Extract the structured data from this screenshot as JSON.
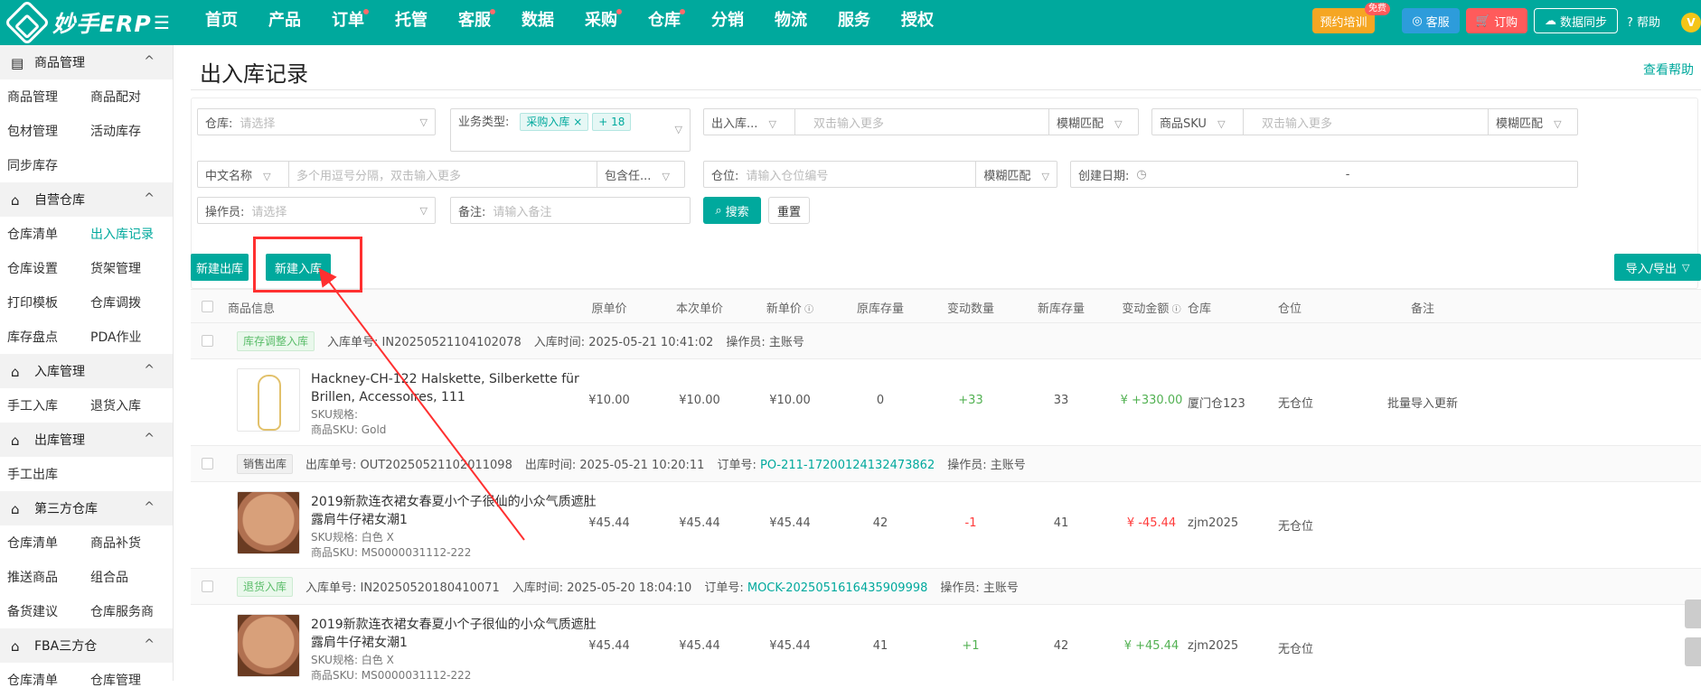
{
  "topbar": {
    "brand": "妙手ERP",
    "nav": [
      {
        "label": "首页",
        "dot": false
      },
      {
        "label": "产品",
        "dot": false
      },
      {
        "label": "订单",
        "dot": true
      },
      {
        "label": "托管",
        "dot": false
      },
      {
        "label": "客服",
        "dot": true
      },
      {
        "label": "数据",
        "dot": false
      },
      {
        "label": "采购",
        "dot": true
      },
      {
        "label": "仓库",
        "dot": true
      },
      {
        "label": "分销",
        "dot": false
      },
      {
        "label": "物流",
        "dot": false
      },
      {
        "label": "服务",
        "dot": false
      },
      {
        "label": "授权",
        "dot": false
      }
    ],
    "training": "预约培训",
    "free_badge": "免费",
    "service": "客服",
    "order": "订购",
    "sync": "数据同步",
    "help": "帮助",
    "avatar": "V"
  },
  "sidebar": {
    "groups": [
      {
        "title": "商品管理",
        "icon": "clipboard-icon",
        "items": [
          [
            "商品管理",
            "商品配对"
          ],
          [
            "包材管理",
            "活动库存"
          ],
          [
            "同步库存",
            ""
          ]
        ]
      },
      {
        "title": "自营仓库",
        "icon": "warehouse-icon",
        "items": [
          [
            "仓库清单",
            "出入库记录"
          ],
          [
            "仓库设置",
            "货架管理"
          ],
          [
            "打印模板",
            "仓库调拨"
          ],
          [
            "库存盘点",
            "PDA作业"
          ]
        ]
      },
      {
        "title": "入库管理",
        "icon": "warehouse-icon",
        "items": [
          [
            "手工入库",
            "退货入库"
          ]
        ]
      },
      {
        "title": "出库管理",
        "icon": "warehouse-icon",
        "items": [
          [
            "手工出库",
            ""
          ]
        ]
      },
      {
        "title": "第三方仓库",
        "icon": "warehouse-icon",
        "items": [
          [
            "仓库清单",
            "商品补货"
          ],
          [
            "推送商品",
            "组合品"
          ],
          [
            "备货建议",
            "仓库服务商"
          ]
        ]
      },
      {
        "title": "FBA三方仓",
        "icon": "warehouse-icon",
        "items": [
          [
            "仓库清单",
            "仓库管理"
          ]
        ]
      }
    ]
  },
  "page": {
    "title": "出入库记录",
    "help_link": "查看帮助"
  },
  "filters": {
    "warehouse_label": "仓库:",
    "warehouse_ph": "请选择",
    "biz_type_label": "业务类型:",
    "biz_type_tag": "采购入库",
    "biz_type_more": "+ 18",
    "inout_select": "出入库...",
    "inout_ph": "双击输入更多",
    "fuzzy1": "模糊匹配",
    "sku_select": "商品SKU",
    "sku_ph": "双击输入更多",
    "fuzzy2": "模糊匹配",
    "cn_name_select": "中文名称",
    "cn_name_ph": "多个用逗号分隔，双击输入更多",
    "contain_select": "包含任...",
    "location_label": "仓位:",
    "location_ph": "请输入仓位编号",
    "fuzzy3": "模糊匹配",
    "created_label": "创建日期:",
    "date_sep": "-",
    "operator_label": "操作员:",
    "operator_ph": "请选择",
    "remark_label": "备注:",
    "remark_ph": "请输入备注",
    "search": "搜索",
    "reset": "重置"
  },
  "actions": {
    "new_out": "新建出库",
    "new_in": "新建入库",
    "import_export": "导入/导出"
  },
  "table": {
    "headers": [
      "商品信息",
      "原单价",
      "本次单价",
      "新单价",
      "原库存量",
      "变动数量",
      "新库存量",
      "变动金额",
      "仓库",
      "仓位",
      "备注"
    ],
    "records": [
      {
        "tag": "库存调整入库",
        "tag_style": "green",
        "no_label": "入库单号:",
        "no": "IN20250521104102078",
        "time_label": "入库时间:",
        "time": "2025-05-21 10:41:02",
        "order_label": "",
        "order_no": "",
        "op_label": "操作员:",
        "op": "主账号",
        "product": {
          "name": "Hackney-CH-122 Halskette, Silberkette für Brillen, Accessoires, 111",
          "sku_spec": "SKU规格:",
          "sku": "商品SKU:   Gold",
          "thumb": "necklace"
        },
        "orig_price": "¥10.00",
        "this_price": "¥10.00",
        "new_price": "¥10.00",
        "orig_stock": "0",
        "change_qty": "+33",
        "new_stock": "33",
        "change_amt": "¥ +330.00",
        "warehouse": "厦门仓123",
        "location": "无仓位",
        "remark": "批量导入更新"
      },
      {
        "tag": "销售出库",
        "tag_style": "gray",
        "no_label": "出库单号:",
        "no": "OUT20250521102011098",
        "time_label": "出库时间:",
        "time": "2025-05-21 10:20:11",
        "order_label": "订单号:",
        "order_no": "PO-211-17200124132473862",
        "op_label": "操作员:",
        "op": "主账号",
        "product": {
          "name": "2019新款连衣裙女春夏小个子很仙的小众气质遮肚露肩牛仔裙女潮1",
          "sku_spec": "SKU规格:   白色 X",
          "sku": "商品SKU:   MS0000031112-222",
          "thumb": "face"
        },
        "orig_price": "¥45.44",
        "this_price": "¥45.44",
        "new_price": "¥45.44",
        "orig_stock": "42",
        "change_qty": "-1",
        "new_stock": "41",
        "change_amt": "¥ -45.44",
        "warehouse": "zjm2025",
        "location": "无仓位",
        "remark": ""
      },
      {
        "tag": "退货入库",
        "tag_style": "green",
        "no_label": "入库单号:",
        "no": "IN20250520180410071",
        "time_label": "入库时间:",
        "time": "2025-05-20 18:04:10",
        "order_label": "订单号:",
        "order_no": "MOCK-2025051616435909998",
        "op_label": "操作员:",
        "op": "主账号",
        "product": {
          "name": "2019新款连衣裙女春夏小个子很仙的小众气质遮肚露肩牛仔裙女潮1",
          "sku_spec": "SKU规格:   白色 X",
          "sku": "商品SKU:   MS0000031112-222",
          "thumb": "face"
        },
        "orig_price": "¥45.44",
        "this_price": "¥45.44",
        "new_price": "¥45.44",
        "orig_stock": "41",
        "change_qty": "+1",
        "new_stock": "42",
        "change_amt": "¥ +45.44",
        "warehouse": "zjm2025",
        "location": "无仓位",
        "remark": ""
      }
    ]
  },
  "colors": {
    "brand": "#00a99d",
    "annotation": "#ff3030"
  }
}
